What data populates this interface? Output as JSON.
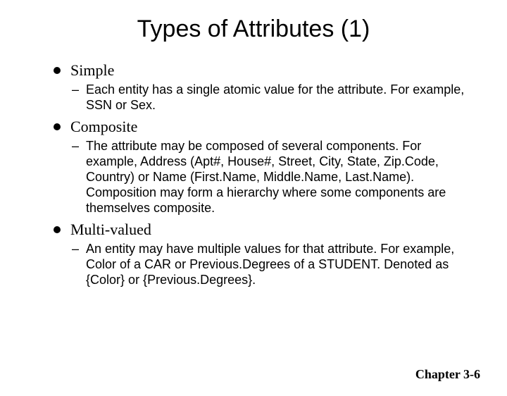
{
  "title": "Types of Attributes (1)",
  "items": [
    {
      "label": "Simple",
      "sub": "Each entity has a single atomic value for the attribute. For example, SSN or Sex."
    },
    {
      "label": "Composite",
      "sub": "The attribute may be composed of several components. For example, Address (Apt#, House#, Street, City, State, Zip.Code, Country) or Name (First.Name, Middle.Name, Last.Name). Composition may form a hierarchy where some components are themselves composite."
    },
    {
      "label": "Multi-valued",
      "sub": "An entity may have multiple values for that attribute. For example, Color of a CAR or Previous.Degrees of a STUDENT. Denoted as {Color} or {Previous.Degrees}."
    }
  ],
  "footer": "Chapter 3-6"
}
